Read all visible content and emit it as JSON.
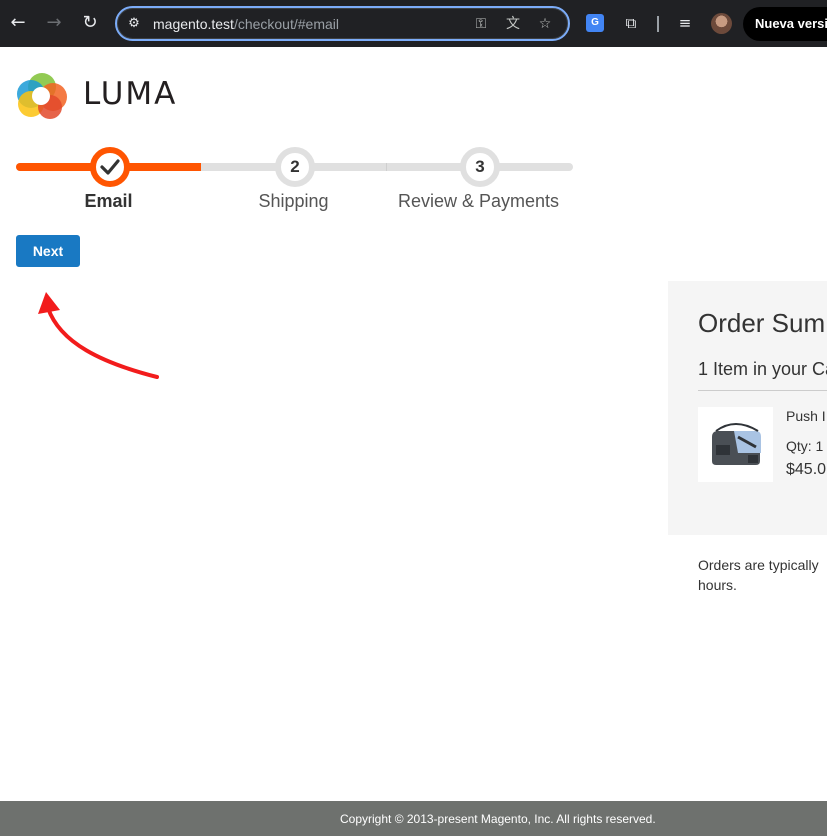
{
  "browser": {
    "url_host": "magento.test",
    "url_path": "/checkout/#email",
    "update_button": "Nueva versi"
  },
  "logo": {
    "text": "LUMA"
  },
  "progress": {
    "steps": [
      {
        "label": "Email",
        "number": "✓",
        "state": "complete"
      },
      {
        "label": "Shipping",
        "number": "2",
        "state": "pending"
      },
      {
        "label": "Review & Payments",
        "number": "3",
        "state": "pending"
      }
    ]
  },
  "next_button": "Next",
  "summary": {
    "title": "Order Sum",
    "cart_count": "1 Item in your Ca",
    "item": {
      "name": "Push I",
      "qty": "Qty: 1",
      "price": "$45.0"
    }
  },
  "shipping_note": {
    "line1": "Orders are typically",
    "line2": "hours."
  },
  "footer": {
    "copyright": "Copyright © 2013-present Magento, Inc. All rights reserved."
  },
  "colors": {
    "accent": "#ff5501",
    "button": "#1979c3",
    "annotation_arrow": "#f21c1c"
  }
}
